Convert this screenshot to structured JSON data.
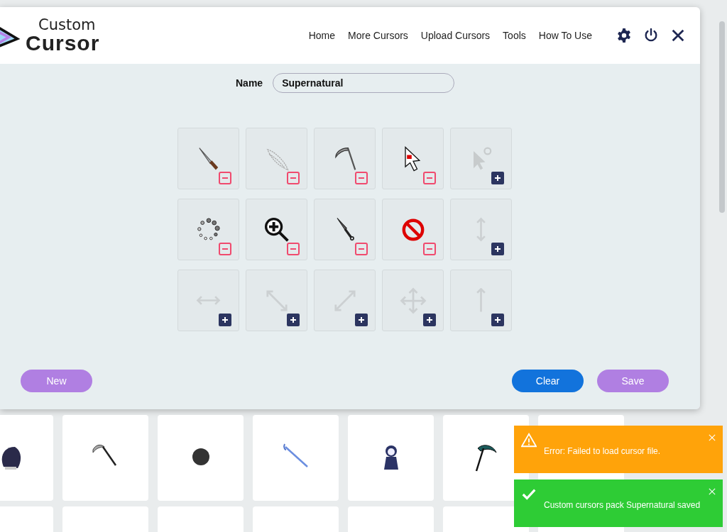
{
  "header": {
    "logo": {
      "line1": "Custom",
      "line2": "Cursor"
    },
    "nav": [
      "Home",
      "More Cursors",
      "Upload Cursors",
      "Tools",
      "How To Use"
    ]
  },
  "name_field": {
    "label": "Name",
    "value": "Supernatural"
  },
  "slots": [
    {
      "assigned": true
    },
    {
      "assigned": true
    },
    {
      "assigned": true
    },
    {
      "assigned": true
    },
    {
      "assigned": false
    },
    {
      "assigned": true
    },
    {
      "assigned": true
    },
    {
      "assigned": true
    },
    {
      "assigned": true
    },
    {
      "assigned": false
    },
    {
      "assigned": false
    },
    {
      "assigned": false
    },
    {
      "assigned": false
    },
    {
      "assigned": false
    },
    {
      "assigned": false
    }
  ],
  "buttons": [
    {
      "label": "New",
      "kind": "new"
    },
    {
      "label": "Clear",
      "kind": "clear"
    },
    {
      "label": "Save",
      "kind": "save"
    }
  ],
  "toasts": [
    {
      "kind": "error",
      "message": "Error: Failed to load cursor file."
    },
    {
      "kind": "success",
      "message": "Custom cursors pack Supernatural saved"
    }
  ]
}
